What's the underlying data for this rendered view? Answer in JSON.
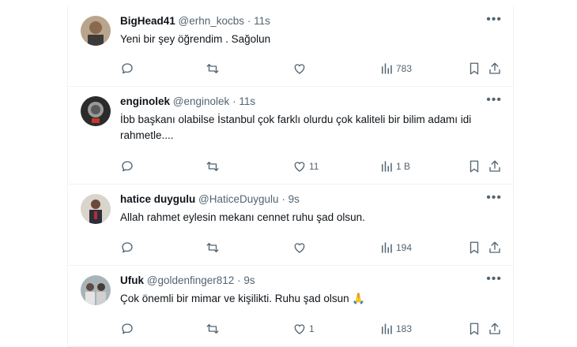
{
  "tweets": [
    {
      "name": "BigHead41",
      "handle": "@erhn_kocbs",
      "time": "11s",
      "text": "Yeni bir şey öğrendim . Sağolun",
      "likes": "",
      "views": "783"
    },
    {
      "name": "enginolek",
      "handle": "@enginolek",
      "time": "11s",
      "text": "İbb başkanı olabilse İstanbul çok farklı olurdu çok kaliteli bir bilim adamı idi rahmetle....",
      "likes": "11",
      "views": "1 B"
    },
    {
      "name": "hatice duygulu",
      "handle": "@HaticeDuygulu",
      "time": "9s",
      "text": "Allah rahmet eylesin mekanı cennet ruhu şad olsun.",
      "likes": "",
      "views": "194"
    },
    {
      "name": "Ufuk",
      "handle": "@goldenfinger812",
      "time": "9s",
      "text": "Çok önemli bir mimar ve kişilikti. Ruhu şad olsun 🙏",
      "likes": "1",
      "views": "183"
    }
  ],
  "separator": "·",
  "more_glyph": "•••",
  "colors": {
    "text_primary": "#0f1419",
    "text_secondary": "#536471",
    "border": "#eff3f4"
  },
  "icons": [
    "reply-icon",
    "retweet-icon",
    "like-icon",
    "views-icon",
    "bookmark-icon",
    "share-icon",
    "more-icon"
  ]
}
